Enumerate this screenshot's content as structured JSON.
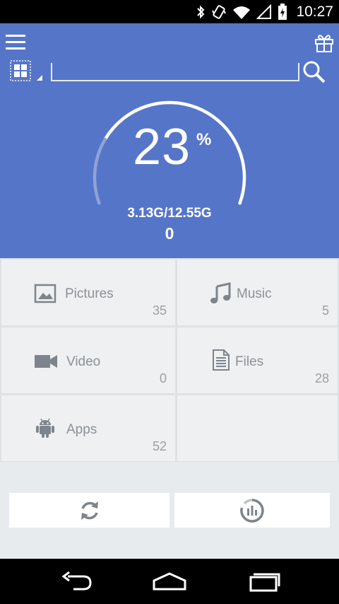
{
  "status_bar": {
    "time": "10:27",
    "icons": [
      "bluetooth-icon",
      "vibrate-icon",
      "wifi-icon",
      "signal-icon",
      "battery-charging-icon"
    ]
  },
  "header": {
    "menu_icon": "hamburger-icon",
    "gift_icon": "gift-icon",
    "view_toggle_icon": "grid-view-icon",
    "search_value": "",
    "search_icon": "search-icon"
  },
  "storage": {
    "percent_value": "23",
    "percent_sign": "%",
    "used_total": "3.13G/12.55G",
    "sub_value": "0",
    "used_fraction": 0.23
  },
  "categories": [
    {
      "label": "Pictures",
      "count": "35",
      "icon": "picture-icon"
    },
    {
      "label": "Music",
      "count": "5",
      "icon": "music-note-icon"
    },
    {
      "label": "Video",
      "count": "0",
      "icon": "video-camera-icon"
    },
    {
      "label": "Files",
      "count": "28",
      "icon": "document-icon"
    },
    {
      "label": "Apps",
      "count": "52",
      "icon": "android-icon"
    }
  ],
  "actions": {
    "left_icon": "refresh-icon",
    "right_icon": "analyze-chart-icon"
  },
  "colors": {
    "hero_bg": "#5575c8",
    "tile_bg": "#eef0f2",
    "tile_text": "#8b9197",
    "icon_gray": "#7d848b"
  },
  "nav": {
    "back_icon": "back-icon",
    "home_icon": "home-icon",
    "recents_icon": "recents-icon"
  }
}
